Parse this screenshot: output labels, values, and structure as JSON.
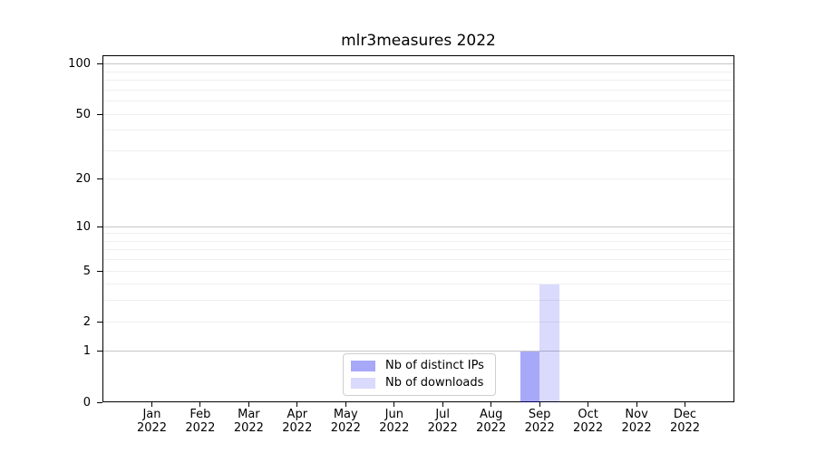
{
  "title": "mlr3measures 2022",
  "chart_data": {
    "type": "bar",
    "title": "mlr3measures 2022",
    "categories": [
      "Jan",
      "Feb",
      "Mar",
      "Apr",
      "May",
      "Jun",
      "Jul",
      "Aug",
      "Sep",
      "Oct",
      "Nov",
      "Dec"
    ],
    "year_label": "2022",
    "series": [
      {
        "name": "Nb of distinct IPs",
        "color": "#a9a9f6",
        "fill": "rgba(0,0,235,0.34)",
        "values": [
          0,
          0,
          0,
          0,
          0,
          0,
          0,
          0,
          1,
          0,
          0,
          0
        ]
      },
      {
        "name": "Nb of downloads",
        "color": "#dbdbfb",
        "fill": "rgba(0,0,235,0.145)",
        "values": [
          0,
          0,
          0,
          0,
          0,
          0,
          0,
          0,
          4,
          0,
          0,
          0
        ]
      }
    ],
    "yscale": "log1p",
    "ylim": [
      0,
      113
    ],
    "yticks": [
      0,
      1,
      2,
      5,
      10,
      20,
      50,
      100
    ],
    "grid": {
      "major_gridlines": [
        1,
        10,
        100
      ],
      "minor_gridlines": [
        2,
        3,
        4,
        5,
        6,
        7,
        8,
        9,
        20,
        30,
        40,
        50,
        60,
        70,
        80,
        90
      ],
      "major_color": "#c6c6c6",
      "minor_color": "#efefef"
    },
    "legend_position": "bottom-center-inside",
    "background": "#ffffff"
  }
}
